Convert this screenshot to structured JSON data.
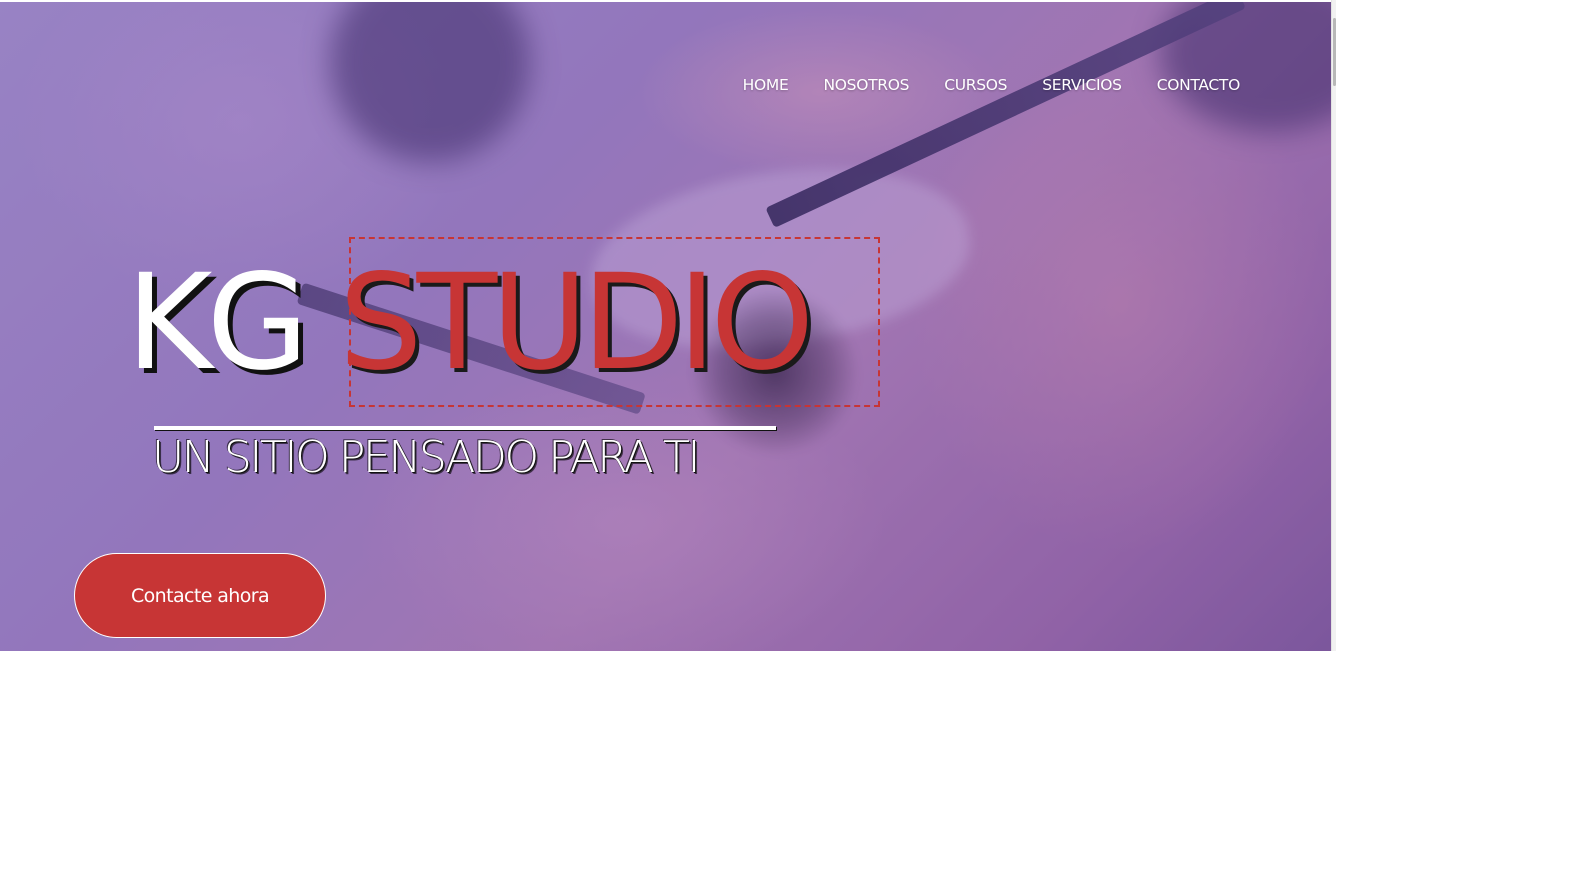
{
  "nav": {
    "items": [
      {
        "label": "HOME"
      },
      {
        "label": "NOSOTROS"
      },
      {
        "label": "CURSOS"
      },
      {
        "label": "SERVICIOS"
      },
      {
        "label": "CONTACTO"
      }
    ]
  },
  "hero": {
    "title_part1": "KG",
    "title_part2": "STUDIO",
    "subtitle": "UN SITIO PENSADO PARA TI",
    "cta_label": "Contacte ahora"
  },
  "colors": {
    "accent": "#c73535",
    "overlay": "#9b7fc0",
    "text": "#ffffff"
  }
}
